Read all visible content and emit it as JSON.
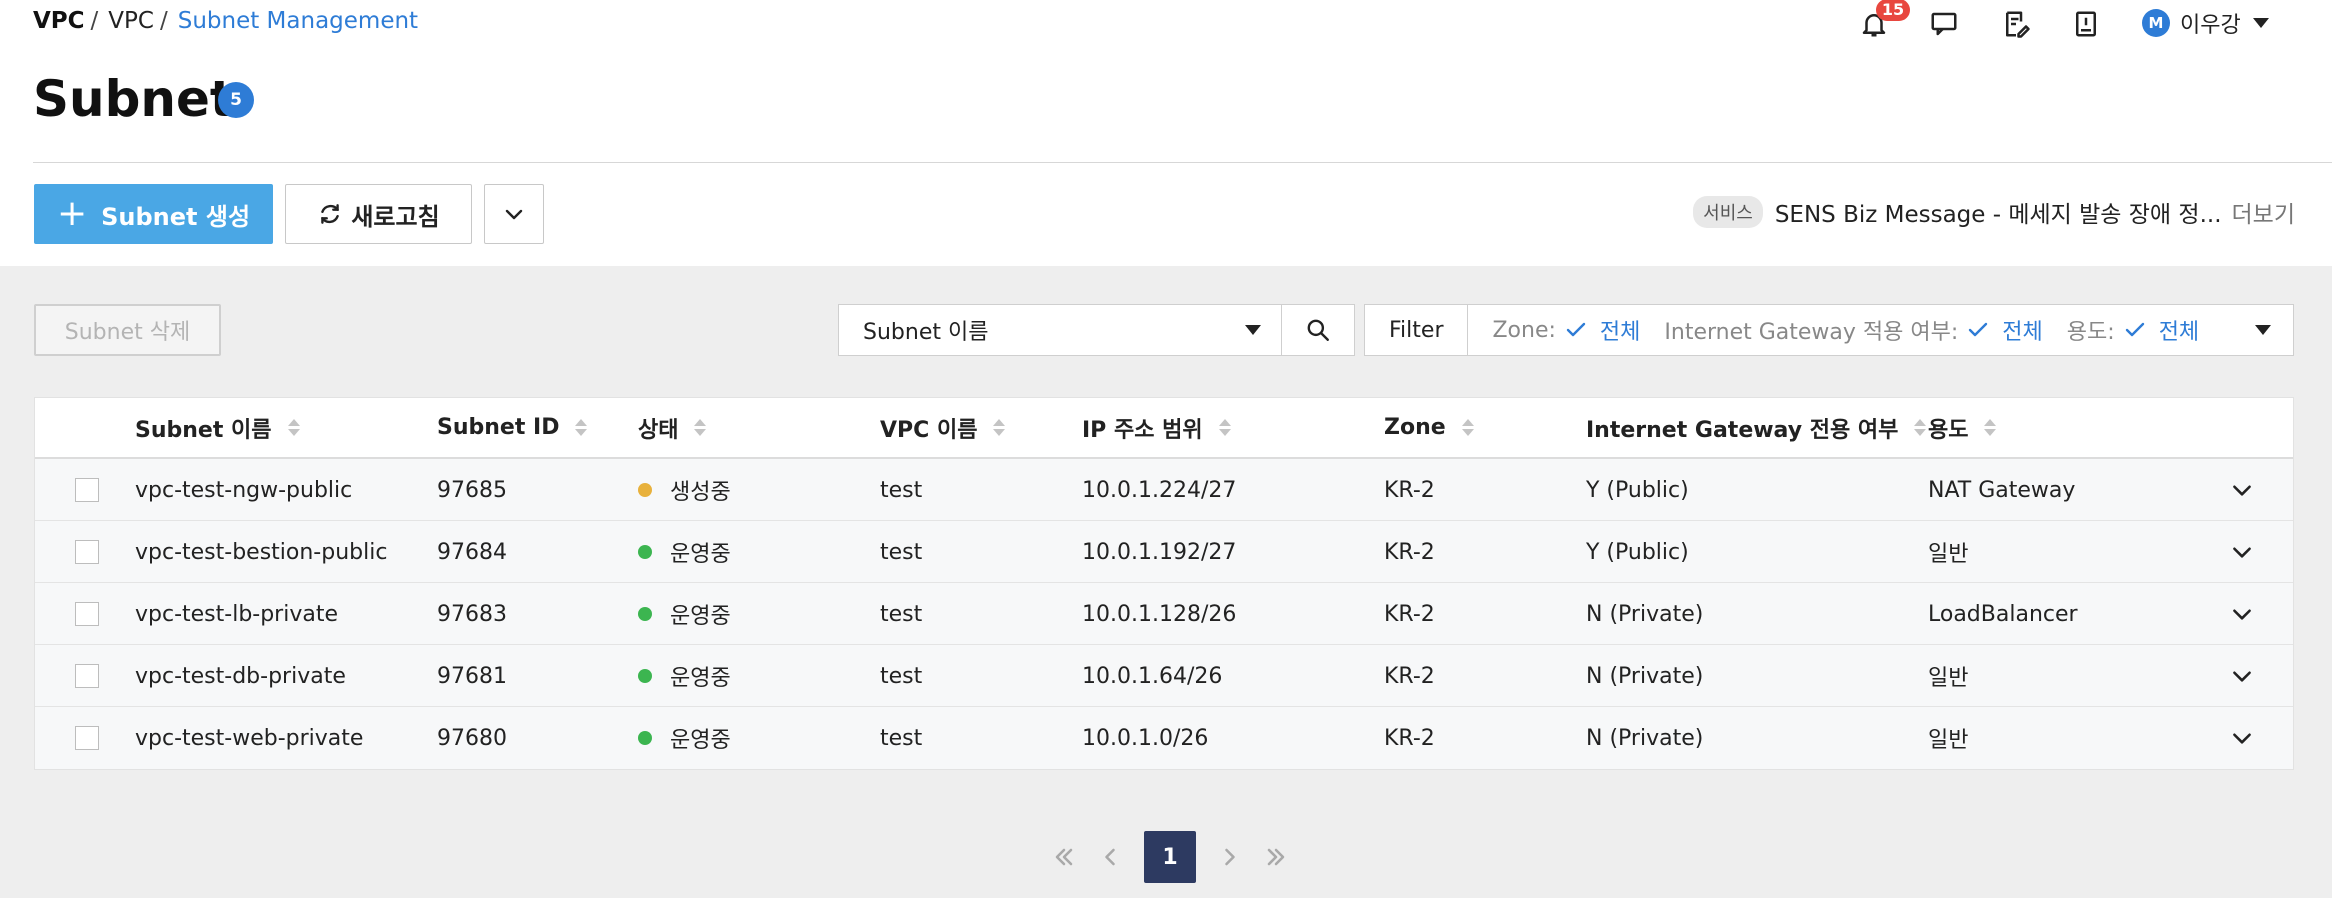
{
  "breadcrumb": {
    "root": "VPC",
    "mid": "VPC",
    "current": "Subnet Management",
    "sep": "/"
  },
  "header": {
    "notifications": {
      "count": "15"
    },
    "user": {
      "avatar_letter": "M",
      "name": "이우강"
    }
  },
  "page": {
    "title": "Subnet",
    "count": "5"
  },
  "toolbar": {
    "create_label": "Subnet 생성",
    "refresh_label": "새로고침"
  },
  "notice": {
    "tag": "서비스",
    "text": "SENS Biz Message - 메세지 발송 장애 정...",
    "more": "더보기"
  },
  "actions": {
    "delete_label": "Subnet 삭제"
  },
  "search": {
    "select_value": "Subnet 이름"
  },
  "filter": {
    "label": "Filter",
    "items": [
      {
        "key": "Zone:",
        "value": "전체"
      },
      {
        "key": "Internet Gateway 적용 여부:",
        "value": "전체"
      },
      {
        "key": "용도:",
        "value": "전체"
      }
    ]
  },
  "table": {
    "columns": [
      "Subnet 이름",
      "Subnet ID",
      "상태",
      "VPC 이름",
      "IP 주소 범위",
      "Zone",
      "Internet Gateway 전용 여부",
      "용도"
    ],
    "rows": [
      {
        "name": "vpc-test-ngw-public",
        "id": "97685",
        "status": "생성중",
        "status_color": "#e8b13c",
        "vpc": "test",
        "ip": "10.0.1.224/27",
        "zone": "KR-2",
        "igw": "Y (Public)",
        "usage": "NAT Gateway"
      },
      {
        "name": "vpc-test-bestion-public",
        "id": "97684",
        "status": "운영중",
        "status_color": "#3cb550",
        "vpc": "test",
        "ip": "10.0.1.192/27",
        "zone": "KR-2",
        "igw": "Y (Public)",
        "usage": "일반"
      },
      {
        "name": "vpc-test-lb-private",
        "id": "97683",
        "status": "운영중",
        "status_color": "#3cb550",
        "vpc": "test",
        "ip": "10.0.1.128/26",
        "zone": "KR-2",
        "igw": "N (Private)",
        "usage": "LoadBalancer"
      },
      {
        "name": "vpc-test-db-private",
        "id": "97681",
        "status": "운영중",
        "status_color": "#3cb550",
        "vpc": "test",
        "ip": "10.0.1.64/26",
        "zone": "KR-2",
        "igw": "N (Private)",
        "usage": "일반"
      },
      {
        "name": "vpc-test-web-private",
        "id": "97680",
        "status": "운영중",
        "status_color": "#3cb550",
        "vpc": "test",
        "ip": "10.0.1.0/26",
        "zone": "KR-2",
        "igw": "N (Private)",
        "usage": "일반"
      }
    ]
  },
  "pagination": {
    "current": "1"
  },
  "colors": {
    "accent": "#2e7cd6",
    "primary_button": "#4aa7e5",
    "badge_red": "#e8473f",
    "pager_active": "#2d3a61"
  },
  "icons": [
    "bell-icon",
    "chat-icon",
    "memo-icon",
    "book-icon",
    "caret-down-icon",
    "plus-icon",
    "refresh-icon",
    "chevron-down-icon",
    "search-icon",
    "check-icon",
    "first-page-icon",
    "prev-page-icon",
    "next-page-icon",
    "last-page-icon"
  ]
}
